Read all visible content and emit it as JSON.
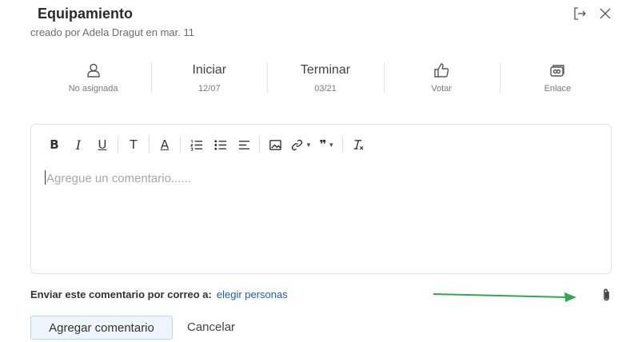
{
  "header": {
    "title": "Equipamiento",
    "subtitle": "creado por Adela Dragut en mar. 11",
    "icons": [
      "exit-icon",
      "close-icon"
    ]
  },
  "meta": {
    "assignee": {
      "icon": "user-icon",
      "label": "No asignada"
    },
    "start": {
      "label": "Iniciar",
      "value": "12/07"
    },
    "end": {
      "label": "Terminar",
      "value": "03/21"
    },
    "vote": {
      "icon": "thumbs-up-icon",
      "label": "Votar"
    },
    "link": {
      "icon": "link-card-icon",
      "label": "Enlace"
    }
  },
  "editor": {
    "toolbar": {
      "bold": "B",
      "italic": "I",
      "underline": "U",
      "text": "T",
      "font_color": "A",
      "quote": "❞"
    },
    "placeholder": "Agregue un comentario......"
  },
  "email": {
    "label": "Enviar este comentario por correo a:",
    "link": "elegir personas"
  },
  "actions": {
    "submit": "Agregar comentario",
    "cancel": "Cancelar"
  },
  "colors": {
    "link": "#1a5fb4",
    "annotation_arrow": "#2fa84f",
    "primary_button_bg": "#eef5fc"
  }
}
